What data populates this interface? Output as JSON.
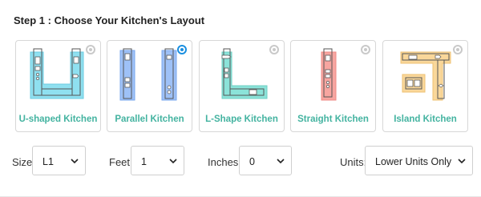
{
  "step": {
    "title": "Step 1 : Choose Your Kitchen's Layout"
  },
  "layouts": [
    {
      "label": "U-shaped Kitchen",
      "selected": false,
      "icon": "u-shaped-layout-icon"
    },
    {
      "label": "Parallel Kitchen",
      "selected": true,
      "icon": "parallel-layout-icon"
    },
    {
      "label": "L-Shape Kitchen",
      "selected": false,
      "icon": "l-shape-layout-icon"
    },
    {
      "label": "Straight Kitchen",
      "selected": false,
      "icon": "straight-layout-icon"
    },
    {
      "label": "Island Kitchen",
      "selected": false,
      "icon": "island-layout-icon"
    }
  ],
  "controls": {
    "size": {
      "label": "Size:",
      "value": "L1"
    },
    "feet": {
      "label": "Feet:",
      "value": "1"
    },
    "inches": {
      "label": "Inches:",
      "value": "0"
    },
    "units": {
      "label": "Units:",
      "value": "Lower Units Only"
    }
  },
  "colors": {
    "label_teal": "#43b3a0",
    "selected_radio": "#1a8fe0",
    "u_fill": "#8fe0f0",
    "parallel_fill": "#9ec1f7",
    "l_fill": "#8be3d9",
    "straight_fill": "#f7a5a0",
    "island_fill": "#f9d79a"
  }
}
